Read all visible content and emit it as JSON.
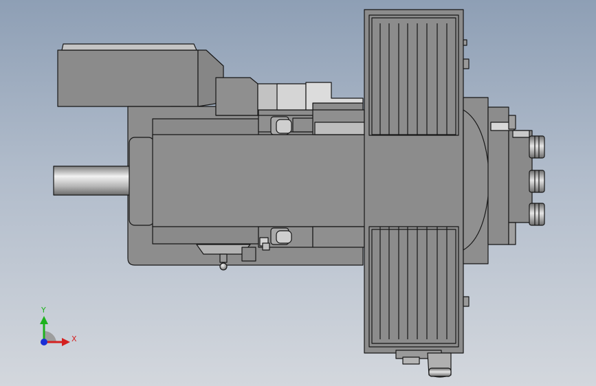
{
  "triad": {
    "y_label": "Y",
    "x_label": "X",
    "y_color": "#1db21d",
    "x_color": "#d42020",
    "z_color": "#1a2fd6"
  },
  "palette": {
    "body": "#8a8a8a",
    "body_light": "#a5a5a5",
    "body_dark": "#6e6e6e",
    "edge": "#161616",
    "shaft": "#c8c8c8"
  }
}
